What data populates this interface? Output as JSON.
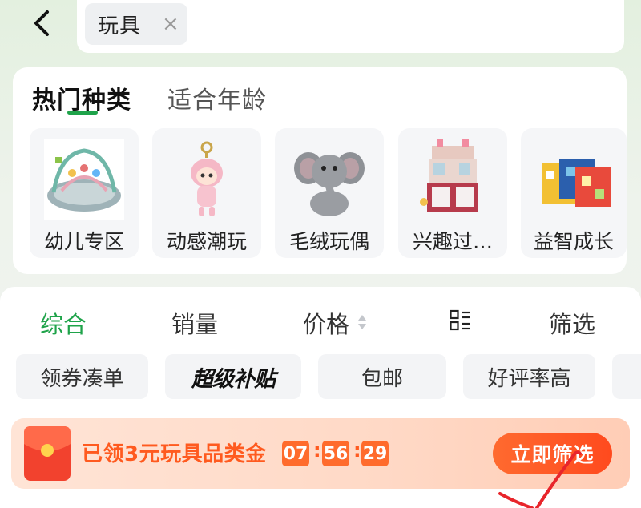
{
  "header": {
    "search_tag": "玩具",
    "search_tag_close": "×"
  },
  "category": {
    "tabs": [
      {
        "label": "热门种类",
        "active": true
      },
      {
        "label": "适合年龄",
        "active": false
      }
    ],
    "items": [
      {
        "label": "幼儿专区",
        "icon": "baby-play-mat-icon"
      },
      {
        "label": "动感潮玩",
        "icon": "doll-keychain-icon"
      },
      {
        "label": "毛绒玩偶",
        "icon": "elephant-plush-icon"
      },
      {
        "label": "兴趣过…",
        "icon": "play-kitchen-icon"
      },
      {
        "label": "益智成长",
        "icon": "puzzle-blocks-icon"
      }
    ]
  },
  "sort": {
    "items": [
      {
        "label": "综合",
        "active": true
      },
      {
        "label": "销量",
        "active": false
      },
      {
        "label": "价格",
        "active": false
      },
      {
        "label": "筛选",
        "active": false
      }
    ]
  },
  "chips": [
    {
      "label": "领券凑单"
    },
    {
      "label": "超级补贴"
    },
    {
      "label": "包邮"
    },
    {
      "label": "好评率高"
    }
  ],
  "coupon": {
    "text": "已领3元玩具品类金",
    "timer": [
      "07",
      "56",
      "29"
    ],
    "separator": ":",
    "button": "立即筛选"
  },
  "colors": {
    "accent_green": "#1fa34a",
    "coupon_orange": "#ff5a1f",
    "button_orange": "#ff4a1e"
  }
}
